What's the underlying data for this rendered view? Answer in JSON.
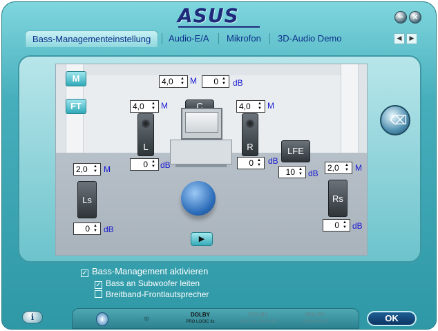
{
  "app": {
    "brand": "ASUS"
  },
  "window": {
    "minimize_glyph": "−",
    "close_glyph": "×"
  },
  "tabs": [
    {
      "label": "Bass-Managementeinstellung",
      "active": true
    },
    {
      "label": "Audio-E/A",
      "active": false
    },
    {
      "label": "Mikrofon",
      "active": false
    },
    {
      "label": "3D-Audio Demo",
      "active": false
    }
  ],
  "tab_nav": {
    "prev": "◀",
    "next": "▶"
  },
  "mode_buttons": {
    "m_label": "M",
    "ft_label": "FT"
  },
  "speakers": {
    "center": {
      "label": "C",
      "distance": "4,0",
      "distance_unit": "M",
      "level": "0",
      "level_unit": "dB"
    },
    "left": {
      "label": "L",
      "distance": "4,0",
      "distance_unit": "M",
      "level": "0",
      "level_unit": "dB"
    },
    "right": {
      "label": "R",
      "distance": "4,0",
      "distance_unit": "M",
      "level": "0",
      "level_unit": "dB"
    },
    "lfe": {
      "label": "LFE",
      "level": "10",
      "level_unit": "dB"
    },
    "left_surround": {
      "label": "Ls",
      "distance": "2,0",
      "distance_unit": "M",
      "level": "0",
      "level_unit": "dB"
    },
    "right_surround": {
      "label": "Rs",
      "distance": "2,0",
      "distance_unit": "M",
      "level": "0",
      "level_unit": "dB"
    }
  },
  "spin_glyphs": {
    "up": "▲",
    "down": "▼"
  },
  "play_glyph": "▶",
  "reset_icon_glyph": "⌫",
  "options": {
    "bass_management": {
      "label": "Bass-Management aktivieren",
      "checked": true
    },
    "bass_to_sub": {
      "label": "Bass an Subwoofer leiten",
      "checked": true
    },
    "broadband_front": {
      "label": "Breitband-Frontlautsprecher",
      "checked": false
    }
  },
  "check_glyph": "✓",
  "bottom_bar": {
    "info_glyph": "i",
    "dolby_prologic": {
      "top": "DOLBY",
      "bottom": "PRO LOGIC IIx"
    },
    "dolby_virtual": {
      "top": "DOLBY",
      "bottom": "VIRTUAL SPEAKER"
    },
    "dolby_headphone": {
      "top": "DOLBY",
      "bottom": "HEADPHONE"
    }
  },
  "footer": {
    "info_glyph": "i",
    "ok_label": "OK"
  },
  "colors": {
    "accent_teal": "#46aebb",
    "text_blue": "#1a1ad0",
    "tab_text": "#0c2e8a",
    "ok_blue": "#0c3563"
  }
}
